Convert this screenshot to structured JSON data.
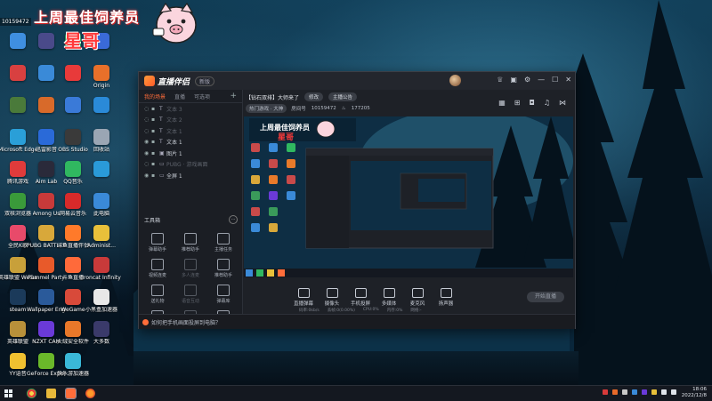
{
  "banner": {
    "title": "上周最佳饲养员",
    "name": "星哥",
    "id": "10159472"
  },
  "desktop_icons": [
    {
      "label": "",
      "color": "#3f8fe0",
      "col": 0,
      "row": 0
    },
    {
      "label": "",
      "color": "#d84040",
      "col": 0,
      "row": 1
    },
    {
      "label": "",
      "color": "#4a7a3a",
      "col": 0,
      "row": 2
    },
    {
      "label": "Microsoft Edge",
      "color": "#2a9fd8",
      "col": 0,
      "row": 3
    },
    {
      "label": "腾讯游戏",
      "color": "#e03b3b",
      "col": 0,
      "row": 4
    },
    {
      "label": "双核浏览器",
      "color": "#3a9a3a",
      "col": 0,
      "row": 5
    },
    {
      "label": "全民K歌",
      "color": "#e84a6a",
      "col": 0,
      "row": 6
    },
    {
      "label": "英雄联盟 WeGame",
      "color": "#c8a03a",
      "col": 0,
      "row": 7
    },
    {
      "label": "steam",
      "color": "#1b3a5a",
      "col": 0,
      "row": 8
    },
    {
      "label": "英雄联盟",
      "color": "#b8903a",
      "col": 0,
      "row": 9
    },
    {
      "label": "YY语音",
      "color": "#f0c030",
      "col": 0,
      "row": 10
    },
    {
      "label": "",
      "color": "#4a4a8a",
      "col": 1,
      "row": 0
    },
    {
      "label": "",
      "color": "#3a8ad8",
      "col": 1,
      "row": 1
    },
    {
      "label": "",
      "color": "#d86a2a",
      "col": 1,
      "row": 2
    },
    {
      "label": "迅雷影音",
      "color": "#2a6ad8",
      "col": 1,
      "row": 3
    },
    {
      "label": "Aim Lab",
      "color": "#2a2a3a",
      "col": 1,
      "row": 4
    },
    {
      "label": "Among Us",
      "color": "#c83a3a",
      "col": 1,
      "row": 5
    },
    {
      "label": "PUBG BATTLEGR...",
      "color": "#d8a83a",
      "col": 1,
      "row": 6
    },
    {
      "label": "Pummel Party",
      "color": "#e85a2a",
      "col": 1,
      "row": 7
    },
    {
      "label": "Wallpaper Engine",
      "color": "#2a5a9a",
      "col": 1,
      "row": 8
    },
    {
      "label": "NZXT CAM",
      "color": "#6a3ad8",
      "col": 1,
      "row": 9
    },
    {
      "label": "GeForce Experience",
      "color": "#6ab82a",
      "col": 1,
      "row": 10
    },
    {
      "label": "",
      "color": "#2a9a5a",
      "col": 2,
      "row": 0
    },
    {
      "label": "",
      "color": "#e83a3a",
      "col": 2,
      "row": 1
    },
    {
      "label": "",
      "color": "#3a7ad8",
      "col": 2,
      "row": 2
    },
    {
      "label": "OBS Studio",
      "color": "#3a3a3a",
      "col": 2,
      "row": 3
    },
    {
      "label": "QQ音乐",
      "color": "#30b860",
      "col": 2,
      "row": 4
    },
    {
      "label": "网易云音乐",
      "color": "#d82a2a",
      "col": 2,
      "row": 5
    },
    {
      "label": "斗鱼直播伴侣",
      "color": "#ff7a2a",
      "col": 2,
      "row": 6
    },
    {
      "label": "斗鱼直播",
      "color": "#ff6a3a",
      "col": 2,
      "row": 7
    },
    {
      "label": "WeGame",
      "color": "#d84a3a",
      "col": 2,
      "row": 8
    },
    {
      "label": "火绒安全软件",
      "color": "#e8782a",
      "col": 2,
      "row": 9
    },
    {
      "label": "快乐游加速器",
      "color": "#3ab8d8",
      "col": 2,
      "row": 10
    },
    {
      "label": "",
      "color": "#3a6ad8",
      "col": 3,
      "row": 0
    },
    {
      "label": "Origin",
      "color": "#e8702a",
      "col": 3,
      "row": 1
    },
    {
      "label": "",
      "color": "#2a8ad8",
      "col": 3,
      "row": 2
    },
    {
      "label": "回收站",
      "color": "#9aa6b4",
      "col": 3,
      "row": 3
    },
    {
      "label": "",
      "color": "#2a9ad8",
      "col": 3,
      "row": 4
    },
    {
      "label": "此电脑",
      "color": "#3a8ad8",
      "col": 3,
      "row": 5
    },
    {
      "label": "Administ...",
      "color": "#e8c03a",
      "col": 3,
      "row": 6
    },
    {
      "label": "Ironcat Infinity",
      "color": "#c83a3a",
      "col": 3,
      "row": 7
    },
    {
      "label": "小黑盒加速器",
      "color": "#e8e8e8",
      "col": 3,
      "row": 8
    },
    {
      "label": "大多数",
      "color": "#3a3a6a",
      "col": 3,
      "row": 9
    }
  ],
  "window": {
    "title": "直播伴侣",
    "badge": "新版",
    "room_title": "【钻石双排】大师来了",
    "edit_label": "修改",
    "notice": "主播公告",
    "category": "热门游戏 · 大神",
    "room_label": "房间号",
    "room_no": "10159472",
    "heat": "177205",
    "left_tabs": [
      "我的场景",
      "直播",
      "可选项"
    ],
    "scenes": [
      {
        "label": "文本 3",
        "dim": true,
        "eye": false,
        "type": "T"
      },
      {
        "label": "文本 2",
        "dim": true,
        "eye": false,
        "type": "T"
      },
      {
        "label": "文本 1",
        "dim": true,
        "eye": false,
        "type": "T"
      },
      {
        "label": "文本 1",
        "dim": false,
        "eye": true,
        "type": "T"
      },
      {
        "label": "图片 1",
        "dim": false,
        "eye": true,
        "type": "▣"
      },
      {
        "label": "PUBG · 游戏画面",
        "dim": true,
        "eye": false,
        "type": "▭"
      },
      {
        "label": "全屏 1",
        "dim": false,
        "eye": true,
        "type": "▭"
      }
    ],
    "toolbox_label": "工具箱",
    "tools": [
      {
        "label": "弹幕助手",
        "dim": false
      },
      {
        "label": "推荐助手",
        "dim": false
      },
      {
        "label": "主播任务",
        "dim": false
      },
      {
        "label": "视频连麦",
        "dim": false
      },
      {
        "label": "多人连麦",
        "dim": true
      },
      {
        "label": "推荐助手",
        "dim": false
      },
      {
        "label": "送礼物",
        "dim": false
      },
      {
        "label": "语音互动",
        "dim": true
      },
      {
        "label": "弹幕库",
        "dim": false
      },
      {
        "label": "",
        "dim": false
      },
      {
        "label": "",
        "dim": true
      },
      {
        "label": "",
        "dim": false
      }
    ],
    "tip": "如何把手机画面投屏到电脑？",
    "controls": [
      "直播弹幕",
      "摄像头",
      "手机投屏",
      "多媒体",
      "麦克风",
      "扬声器"
    ],
    "start_live": "开始直播",
    "stats": [
      "码率:0kb/s",
      "丢帧:0(0.00%)",
      "CPU:0%",
      "内存:0%",
      "网络:-"
    ]
  },
  "taskbar": {
    "time": "18:06",
    "date": "2022/12/8"
  }
}
